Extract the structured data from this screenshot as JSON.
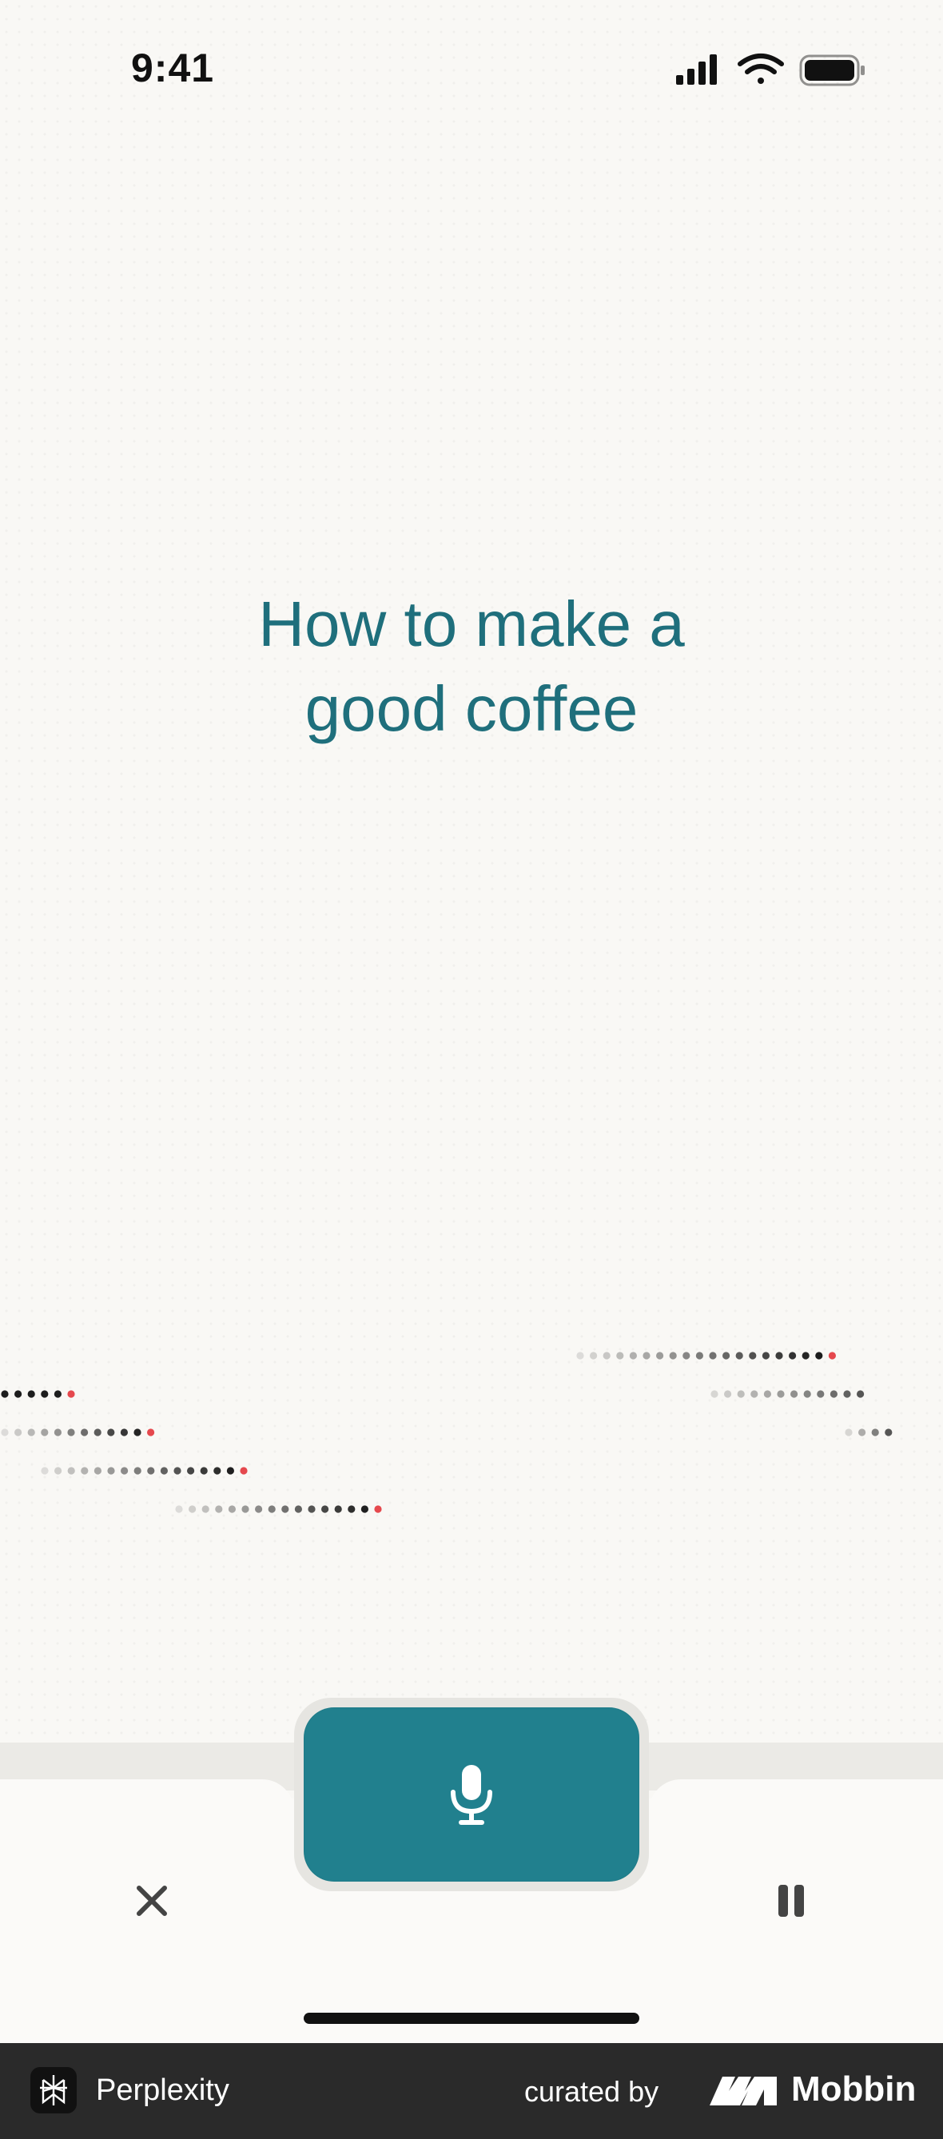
{
  "status_bar": {
    "time": "9:41",
    "icons": [
      "cellular-signal-icon",
      "wifi-icon",
      "battery-icon"
    ]
  },
  "query": {
    "line1": "How to make a",
    "line2": "good coffee"
  },
  "controls": {
    "close_icon": "close-icon",
    "mic_icon": "microphone-icon",
    "pause_icon": "pause-icon"
  },
  "footer": {
    "app_name": "Perplexity",
    "curated_by": "curated by",
    "brand": "Mobbin"
  },
  "colors": {
    "accent": "#21808e",
    "query_text": "#1f6f7c",
    "dot_dark": "#111111",
    "dot_highlight": "#e5484d",
    "footer_bg": "#2a2a2a"
  }
}
